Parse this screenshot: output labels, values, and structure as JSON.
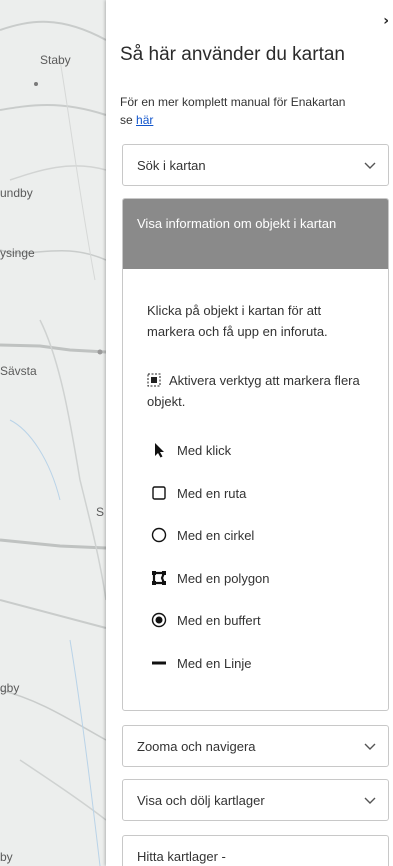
{
  "map": {
    "labels": [
      "Staby",
      "undby",
      "ysinge",
      "Sävsta",
      "S",
      "gby",
      "by"
    ]
  },
  "panel": {
    "close_symbol": "›",
    "title": "Så här använder du kartan",
    "intro_prefix": "För en mer komplett manual för Enakartan se ",
    "intro_link": "här",
    "sections": {
      "search": "Sök i kartan",
      "info": "Visa information om objekt i kartan",
      "zoom": "Zooma och navigera",
      "layers": "Visa och dölj kartlager",
      "find": "Hitta kartlager -"
    },
    "info_body": {
      "text1": "Klicka på objekt i kartan för att markera och få upp en inforuta.",
      "text2": "Aktivera verktyg att markera flera objekt.",
      "tools": [
        {
          "label": "Med klick",
          "icon": "pointer-icon"
        },
        {
          "label": "Med en ruta",
          "icon": "square-icon"
        },
        {
          "label": "Med en cirkel",
          "icon": "circle-icon"
        },
        {
          "label": "Med en polygon",
          "icon": "polygon-icon"
        },
        {
          "label": "Med en buffert",
          "icon": "buffer-icon"
        },
        {
          "label": "Med en Linje",
          "icon": "line-icon"
        }
      ]
    }
  },
  "colors": {
    "panel_header": "#8a8a8a",
    "link": "#1155cc"
  }
}
